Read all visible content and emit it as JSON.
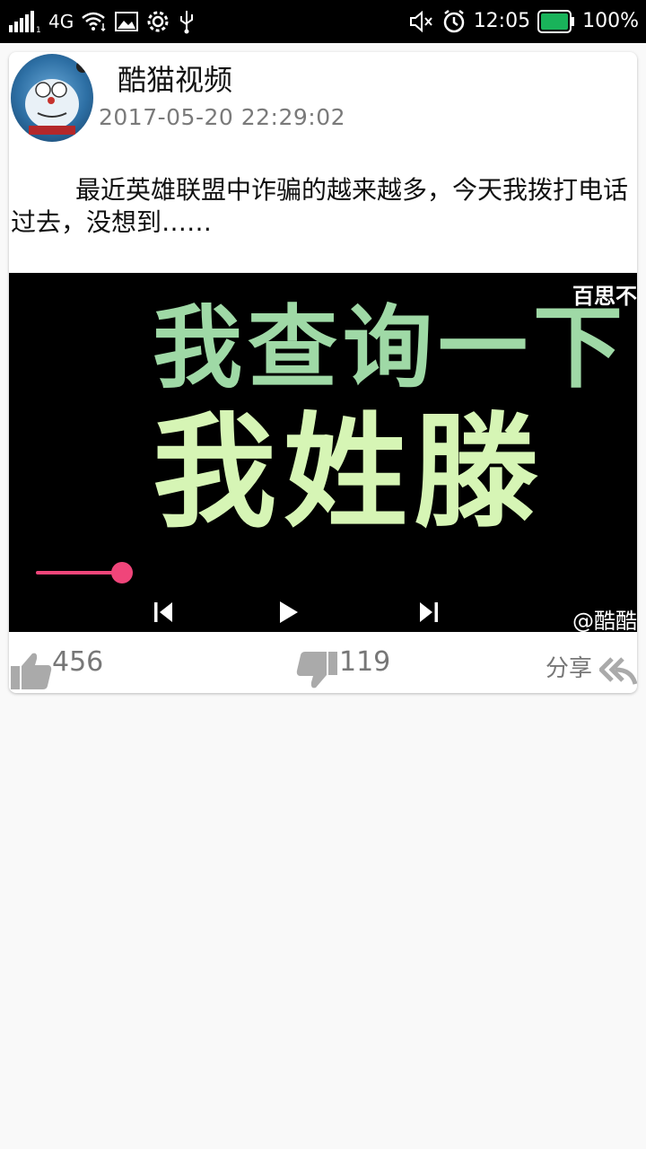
{
  "status_bar": {
    "network": "4G",
    "time": "12:05",
    "battery": "100%",
    "icons_left": [
      "signal-icon",
      "wifi-icon",
      "image-icon",
      "gear-icon",
      "usb-icon"
    ],
    "icons_right": [
      "mute-icon",
      "alarm-icon",
      "battery-icon"
    ]
  },
  "post": {
    "username": "酷猫视频",
    "timestamp": "2017-05-20 22:29:02",
    "text": "最近英雄联盟中诈骗的越来越多，今天我拨打电话过去，没想到……"
  },
  "video": {
    "caption_line1": "我查询一下",
    "caption_line2": "我姓滕",
    "watermark_top": "百思不",
    "watermark_bottom": "@酷酷",
    "progress": 0.15,
    "progress_color": "#f0457a"
  },
  "actions": {
    "likes": "456",
    "dislikes": "119",
    "share_label": "分享"
  }
}
